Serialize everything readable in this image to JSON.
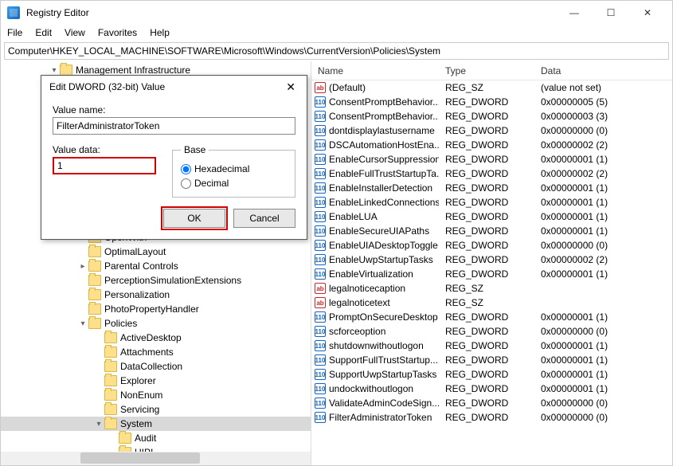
{
  "window": {
    "title": "Registry Editor",
    "minimize": "—",
    "maximize": "☐",
    "close": "✕"
  },
  "menu": {
    "file": "File",
    "edit": "Edit",
    "view": "View",
    "favorites": "Favorites",
    "help": "Help"
  },
  "address": "Computer\\HKEY_LOCAL_MACHINE\\SOFTWARE\\Microsoft\\Windows\\CurrentVersion\\Policies\\System",
  "tree": {
    "top": "Management Infrastructure",
    "nodes": [
      "OpenWith",
      "OptimalLayout",
      "Parental Controls",
      "PerceptionSimulationExtensions",
      "Personalization",
      "PhotoPropertyHandler",
      "Policies",
      "ActiveDesktop",
      "Attachments",
      "DataCollection",
      "Explorer",
      "NonEnum",
      "Servicing",
      "System",
      "Audit",
      "UIPI"
    ]
  },
  "columns": {
    "name": "Name",
    "type": "Type",
    "data": "Data"
  },
  "values": [
    {
      "icon": "sz",
      "name": "(Default)",
      "type": "REG_SZ",
      "data": "(value not set)"
    },
    {
      "icon": "dword",
      "name": "ConsentPromptBehavior...",
      "type": "REG_DWORD",
      "data": "0x00000005 (5)"
    },
    {
      "icon": "dword",
      "name": "ConsentPromptBehavior...",
      "type": "REG_DWORD",
      "data": "0x00000003 (3)"
    },
    {
      "icon": "dword",
      "name": "dontdisplaylastusername",
      "type": "REG_DWORD",
      "data": "0x00000000 (0)"
    },
    {
      "icon": "dword",
      "name": "DSCAutomationHostEna...",
      "type": "REG_DWORD",
      "data": "0x00000002 (2)"
    },
    {
      "icon": "dword",
      "name": "EnableCursorSuppression",
      "type": "REG_DWORD",
      "data": "0x00000001 (1)"
    },
    {
      "icon": "dword",
      "name": "EnableFullTrustStartupTa...",
      "type": "REG_DWORD",
      "data": "0x00000002 (2)"
    },
    {
      "icon": "dword",
      "name": "EnableInstallerDetection",
      "type": "REG_DWORD",
      "data": "0x00000001 (1)"
    },
    {
      "icon": "dword",
      "name": "EnableLinkedConnections",
      "type": "REG_DWORD",
      "data": "0x00000001 (1)"
    },
    {
      "icon": "dword",
      "name": "EnableLUA",
      "type": "REG_DWORD",
      "data": "0x00000001 (1)"
    },
    {
      "icon": "dword",
      "name": "EnableSecureUIAPaths",
      "type": "REG_DWORD",
      "data": "0x00000001 (1)"
    },
    {
      "icon": "dword",
      "name": "EnableUIADesktopToggle",
      "type": "REG_DWORD",
      "data": "0x00000000 (0)"
    },
    {
      "icon": "dword",
      "name": "EnableUwpStartupTasks",
      "type": "REG_DWORD",
      "data": "0x00000002 (2)"
    },
    {
      "icon": "dword",
      "name": "EnableVirtualization",
      "type": "REG_DWORD",
      "data": "0x00000001 (1)"
    },
    {
      "icon": "sz",
      "name": "legalnoticecaption",
      "type": "REG_SZ",
      "data": ""
    },
    {
      "icon": "sz",
      "name": "legalnoticetext",
      "type": "REG_SZ",
      "data": ""
    },
    {
      "icon": "dword",
      "name": "PromptOnSecureDesktop",
      "type": "REG_DWORD",
      "data": "0x00000001 (1)"
    },
    {
      "icon": "dword",
      "name": "scforceoption",
      "type": "REG_DWORD",
      "data": "0x00000000 (0)"
    },
    {
      "icon": "dword",
      "name": "shutdownwithoutlogon",
      "type": "REG_DWORD",
      "data": "0x00000001 (1)"
    },
    {
      "icon": "dword",
      "name": "SupportFullTrustStartup...",
      "type": "REG_DWORD",
      "data": "0x00000001 (1)"
    },
    {
      "icon": "dword",
      "name": "SupportUwpStartupTasks",
      "type": "REG_DWORD",
      "data": "0x00000001 (1)"
    },
    {
      "icon": "dword",
      "name": "undockwithoutlogon",
      "type": "REG_DWORD",
      "data": "0x00000001 (1)"
    },
    {
      "icon": "dword",
      "name": "ValidateAdminCodeSign...",
      "type": "REG_DWORD",
      "data": "0x00000000 (0)"
    },
    {
      "icon": "dword",
      "name": "FilterAdministratorToken",
      "type": "REG_DWORD",
      "data": "0x00000000 (0)"
    }
  ],
  "dialog": {
    "title": "Edit DWORD (32-bit) Value",
    "close": "✕",
    "value_name_label": "Value name:",
    "value_name": "FilterAdministratorToken",
    "value_data_label": "Value data:",
    "value_data": "1",
    "base_label": "Base",
    "hex_label": "Hexadecimal",
    "dec_label": "Decimal",
    "ok": "OK",
    "cancel": "Cancel"
  },
  "icon_glyphs": {
    "sz": "ab",
    "dword": "110"
  }
}
